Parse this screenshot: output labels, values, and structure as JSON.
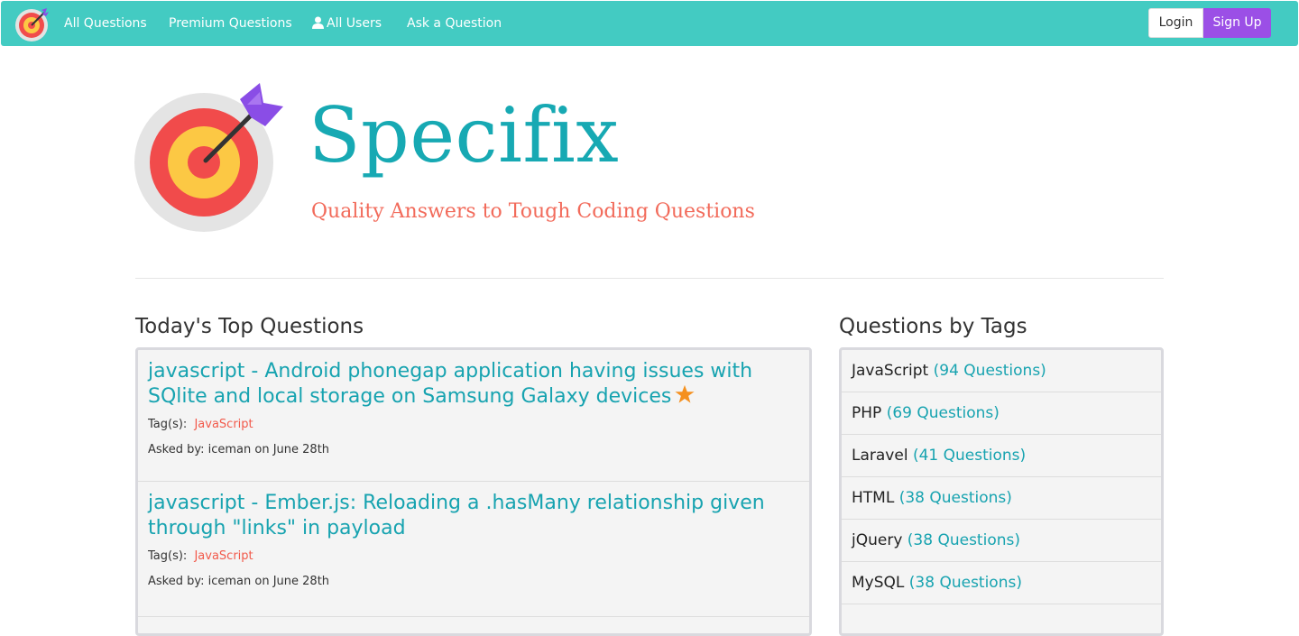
{
  "navbar": {
    "logo": "target-logo-icon",
    "links": [
      {
        "label": "All Questions"
      },
      {
        "label": "Premium Questions"
      },
      {
        "label": "All Users",
        "icon": "user-icon"
      },
      {
        "label": "Ask a Question"
      }
    ],
    "login_label": "Login",
    "signup_label": "Sign Up",
    "colors": {
      "bar": "#43cbc2",
      "signup": "#9b4fe6"
    }
  },
  "hero": {
    "brand": "Specifix",
    "tagline": "Quality Answers to Tough Coding Questions",
    "logo": "target-arrow-icon",
    "colors": {
      "brand": "#17a9b3",
      "tagline": "#f26b5b"
    }
  },
  "top_questions": {
    "heading": "Today's Top Questions",
    "items": [
      {
        "title": "javascript - Android phonegap application having issues with SQlite and local storage on Samsung Galaxy devices",
        "premium_icon": "star-icon",
        "tags_label": "Tag(s):",
        "tag": "JavaScript",
        "asked": "Asked by: iceman on June 28th"
      },
      {
        "title": "javascript - Ember.js: Reloading a .hasMany relationship given through \"links\" in payload",
        "tags_label": "Tag(s):",
        "tag": "JavaScript",
        "asked": "Asked by: iceman on June 28th"
      }
    ]
  },
  "tags": {
    "heading": "Questions by Tags",
    "items": [
      {
        "name": "JavaScript",
        "count": "(94 Questions)"
      },
      {
        "name": "PHP",
        "count": "(69 Questions)"
      },
      {
        "name": "Laravel",
        "count": "(41 Questions)"
      },
      {
        "name": "HTML",
        "count": "(38 Questions)"
      },
      {
        "name": "jQuery",
        "count": "(38 Questions)"
      },
      {
        "name": "MySQL",
        "count": "(38 Questions)"
      }
    ]
  }
}
